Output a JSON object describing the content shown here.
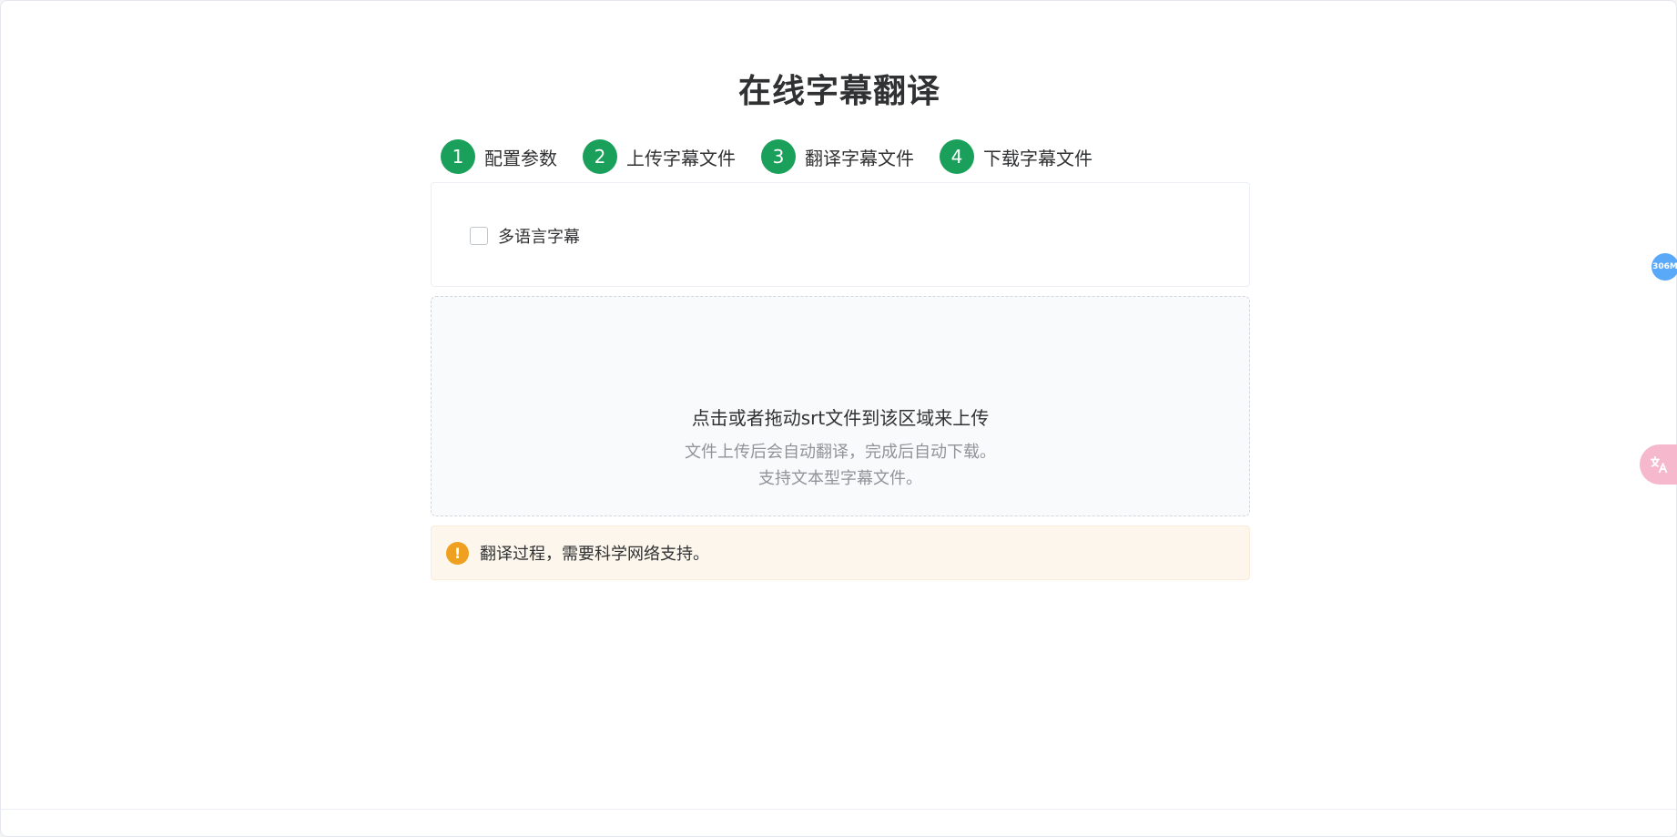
{
  "page": {
    "title": "在线字幕翻译"
  },
  "steps": [
    {
      "number": "1",
      "label": "配置参数"
    },
    {
      "number": "2",
      "label": "上传字幕文件"
    },
    {
      "number": "3",
      "label": "翻译字幕文件"
    },
    {
      "number": "4",
      "label": "下载字幕文件"
    }
  ],
  "config": {
    "multilang_label": "多语言字幕",
    "multilang_checked": false
  },
  "upload": {
    "main_text": "点击或者拖动srt文件到该区域来上传",
    "sub_line1": "文件上传后会自动翻译，完成后自动下载。",
    "sub_line2": "支持文本型字幕文件。"
  },
  "alert": {
    "icon": "warning-icon",
    "text": "翻译过程，需要科学网络支持。"
  },
  "floating": {
    "memory_badge": "306M",
    "translate_icon": "translate-icon"
  },
  "colors": {
    "step_green": "#1aa05a",
    "warning": "#f0a020",
    "alert_bg": "#fdf6ec",
    "badge_blue": "#5aa9f8",
    "fab_pink": "#f6b8cc"
  }
}
